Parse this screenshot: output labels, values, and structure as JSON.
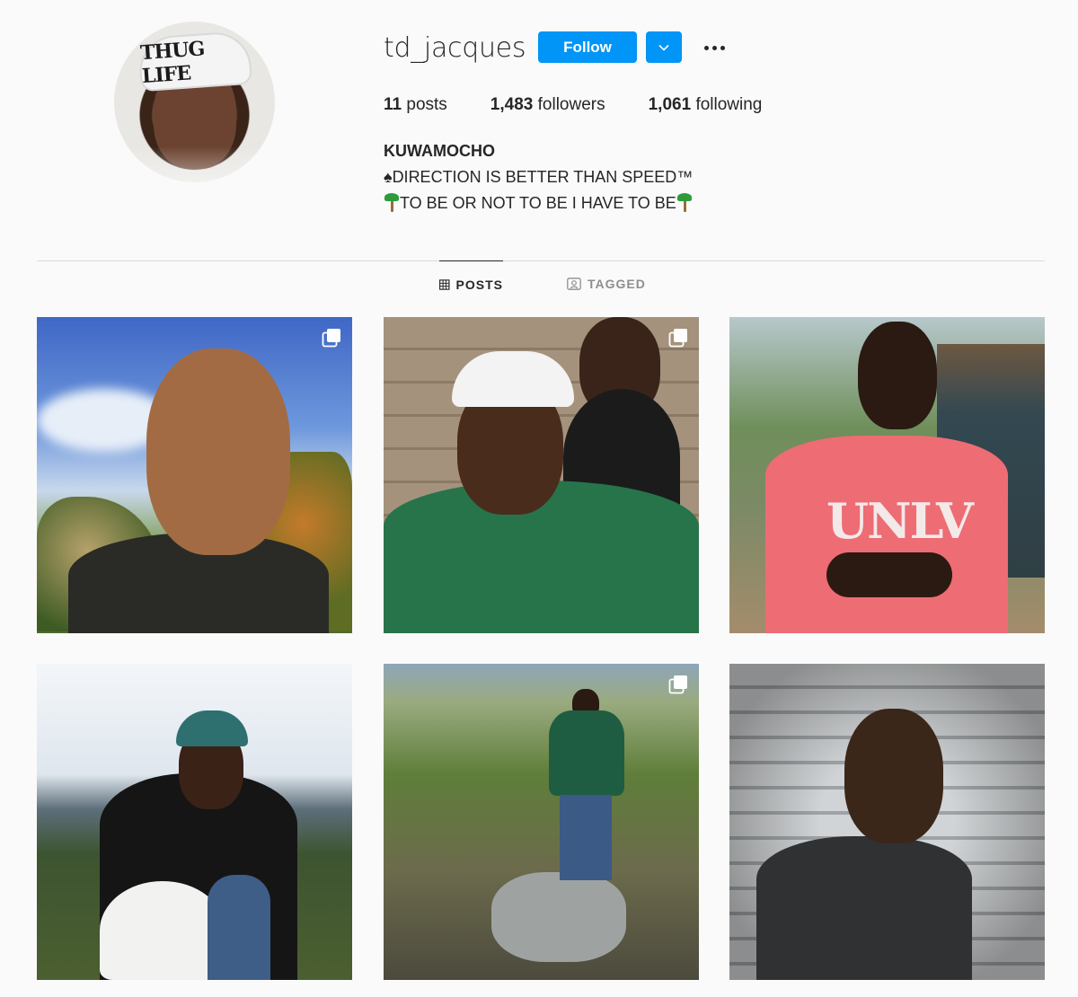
{
  "profile": {
    "username": "td_jacques",
    "avatar_text": "THUG LIFE",
    "follow_label": "Follow",
    "stats": {
      "posts_count": "11",
      "posts_label": "posts",
      "followers_count": "1,483",
      "followers_label": "followers",
      "following_count": "1,061",
      "following_label": "following"
    },
    "bio": {
      "full_name": "KUWAMOCHO",
      "line1": "♠DIRECTION IS BETTER THAN SPEED™",
      "line2": "TO BE OR NOT TO BE I HAVE TO BE"
    }
  },
  "tabs": [
    {
      "label": "POSTS",
      "icon": "grid-icon",
      "active": true
    },
    {
      "label": "TAGGED",
      "icon": "tag-person-icon",
      "active": false
    }
  ],
  "posts": [
    {
      "multiple": true,
      "image_text": ""
    },
    {
      "multiple": true,
      "image_text": ""
    },
    {
      "multiple": false,
      "image_text": "UNLV"
    },
    {
      "multiple": false,
      "image_text": ""
    },
    {
      "multiple": true,
      "image_text": ""
    },
    {
      "multiple": false,
      "image_text": ""
    }
  ],
  "colors": {
    "accent": "#0095f6",
    "text": "#262626",
    "muted": "#8e8e8e",
    "background": "#fafafa",
    "divider": "#dbdbdb"
  }
}
